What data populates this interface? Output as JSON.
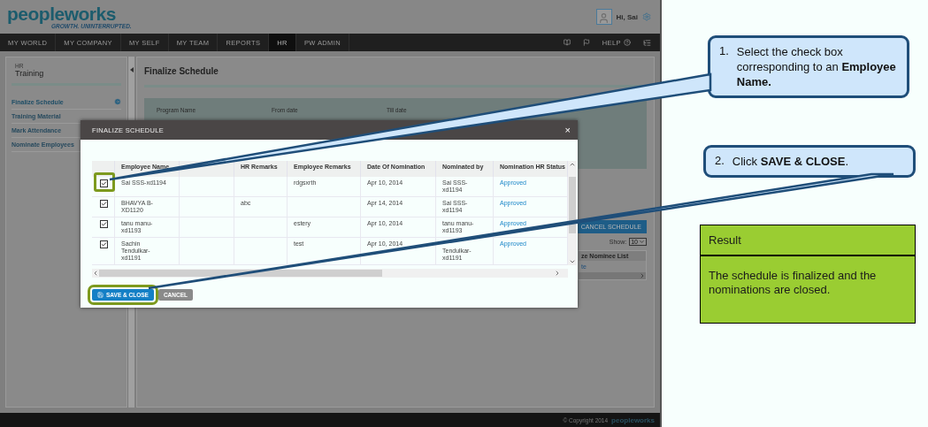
{
  "app": {
    "logo": "peopleworks",
    "tagline": "GROWTH. UNINTERRUPTED.",
    "greeting": "Hi, Sai",
    "nav": [
      {
        "label": "MY WORLD",
        "selected": false
      },
      {
        "label": "MY COMPANY",
        "selected": false
      },
      {
        "label": "MY SELF",
        "selected": false
      },
      {
        "label": "MY TEAM",
        "selected": false
      },
      {
        "label": "REPORTS",
        "selected": false
      },
      {
        "label": "HR",
        "selected": true
      },
      {
        "label": "PW ADMIN",
        "selected": false
      }
    ],
    "help": "HELP",
    "sidebar": {
      "section": "HR",
      "title": "Training",
      "items": [
        {
          "label": "Finalize Schedule",
          "selected": true
        },
        {
          "label": "Training Material",
          "selected": false
        },
        {
          "label": "Mark Attendance",
          "selected": false
        },
        {
          "label": "Nominate Employees",
          "selected": false
        }
      ]
    },
    "page_title": "Finalize Schedule",
    "filters": [
      "Program Name",
      "From date",
      "Till date"
    ],
    "cancel_button": "CANCEL SCHEDULE",
    "show_label": "Show:",
    "show_value": "10",
    "list_heading": "ze Nominee List",
    "list_link": "te",
    "footer": {
      "copyright": "© Copyright 2014",
      "logo": "peopleworks"
    }
  },
  "dialog": {
    "title": "FINALIZE SCHEDULE",
    "close": "×",
    "columns": [
      "Employee Name",
      null,
      "HR Remarks",
      "Employee Remarks",
      "Date Of Nomination",
      "Nominated by",
      "Nomination HR Status"
    ],
    "rows": [
      {
        "checked": true,
        "highlighted": true,
        "cells": [
          "Sai SSS-xd1194",
          null,
          null,
          "rdgsxrth",
          "Apr 10, 2014",
          "Sai SSS-xd1194",
          "Approved"
        ]
      },
      {
        "checked": true,
        "highlighted": false,
        "cells": [
          "BHAVYA B-XD1120",
          null,
          "abc",
          null,
          "Apr 14, 2014",
          "Sai SSS-xd1194",
          "Approved"
        ]
      },
      {
        "checked": true,
        "highlighted": false,
        "cells": [
          "tanu manu-xd1193",
          null,
          null,
          "estery",
          "Apr 10, 2014",
          "tanu manu-xd1193",
          "Approved"
        ]
      },
      {
        "checked": true,
        "highlighted": false,
        "cells": [
          "Sachin Tendulkar-xd1191",
          null,
          null,
          "test",
          "Apr 10, 2014",
          "Tendulkar-xd1191",
          "Approved"
        ]
      }
    ],
    "buttons": [
      {
        "label": "SAVE & CLOSE",
        "kind": "primary",
        "highlighted": true
      },
      {
        "label": "CANCEL",
        "kind": "secondary",
        "highlighted": false
      }
    ]
  },
  "callouts": [
    {
      "number": "1.",
      "text": "Select the check box corresponding to an **Employee Name.**"
    },
    {
      "number": "2.",
      "text": "Click **SAVE & CLOSE**."
    }
  ],
  "result": {
    "title": "Result",
    "text": "The schedule is finalized and the nominations are closed."
  }
}
